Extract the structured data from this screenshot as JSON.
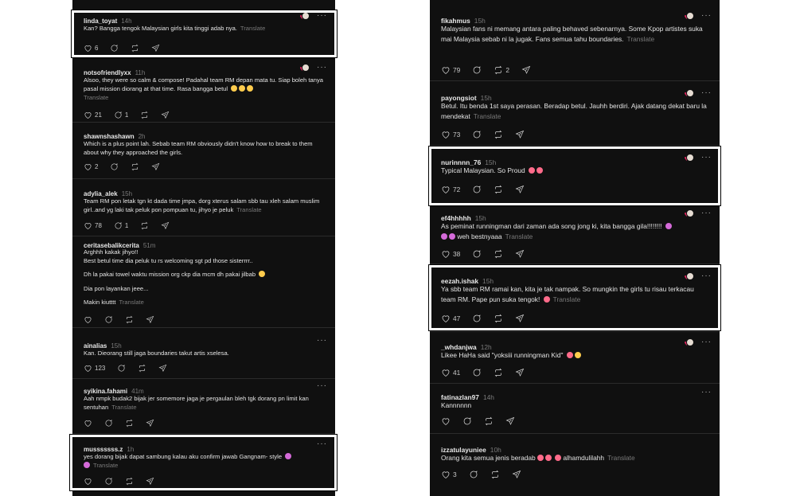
{
  "left": [
    {
      "user": "linda_toyat",
      "time": "14h",
      "text": "Kan? Bangga tengok Malaysian girls kita tinggi adab nya.",
      "translate": "Translate",
      "likes": "6",
      "replies": "",
      "reposts": "",
      "author_liked": true
    },
    {
      "user": "notsofriendlyxx",
      "time": "11h",
      "text": "Alsoo, they were so calm & compose! Padahal team RM depan mata tu. Siap boleh tanya pasal mission diorang at that time. Rasa bangga betul",
      "translate": "Translate",
      "likes": "21",
      "replies": "1",
      "reposts": "",
      "author_liked": true
    },
    {
      "user": "shawnshashawn",
      "time": "2h",
      "text": "Which is a plus point lah. Sebab team RM obviously didn't know how to break to them about why they approached the girls.",
      "translate": "",
      "likes": "2",
      "replies": "",
      "reposts": "",
      "author_liked": false
    },
    {
      "user": "adylia_alek",
      "time": "15h",
      "text": "Team RM pon letak tgn kt dada time jmpa, dorg xterus salam sbb tau xleh salam muslim girl..and yg laki tak peluk pon pompuan tu, jihyo je peluk",
      "translate": "Translate",
      "likes": "78",
      "replies": "1",
      "reposts": "",
      "author_liked": false
    },
    {
      "user": "ceritasebalikcerita",
      "time": "51m",
      "lines": [
        "Arghhh kakak jihyo!!",
        "Best betul time dia peluk tu rs welcoming sgt pd those sisterrrr..",
        "",
        "Dh la pakai towel waktu mission org ckp dia mcm dh pakai jilbab",
        "",
        "Dia pon layankan jeee...",
        "",
        "Makin kiutttt"
      ],
      "translate": "Translate",
      "likes": "",
      "replies": "",
      "reposts": "",
      "author_liked": false
    },
    {
      "user": "ainalias",
      "time": "15h",
      "text": "Kan. Dieorang still jaga boundaries takut artis xselesa.",
      "translate": "",
      "likes": "123",
      "replies": "",
      "reposts": "",
      "author_liked": false
    },
    {
      "user": "syikina.fahami",
      "time": "41m",
      "text": "Aah nmpk budak2 bijak jer somemore jaga je pergaulan bleh tgk dorang pn limit kan sentuhan",
      "translate": "Translate",
      "likes": "",
      "replies": "",
      "reposts": "",
      "author_liked": false
    },
    {
      "user": "musssssss.z",
      "time": "1h",
      "text": "yes dorang bijak dapat sambung kalau aku confirm jawab Gangnam- style",
      "translate": "Translate",
      "likes": "",
      "replies": "",
      "reposts": "",
      "author_liked": false
    }
  ],
  "right": [
    {
      "user": "fikahmus",
      "time": "15h",
      "text": "Malaysian fans ni memang antara paling behaved sebenarnya. Some Kpop artistes suka mai Malaysia sebab ni la jugak. Fans semua tahu boundaries.",
      "translate": "Translate",
      "likes": "79",
      "replies": "",
      "reposts": "2",
      "author_liked": true
    },
    {
      "user": "payongsiot",
      "time": "15h",
      "text": "Betul. Itu benda 1st saya perasan. Beradap betul. Jauhh berdiri. Ajak datang dekat baru la mendekat",
      "translate": "Translate",
      "likes": "73",
      "replies": "",
      "reposts": "",
      "author_liked": true
    },
    {
      "user": "nurinnnn_76",
      "time": "15h",
      "text": "Typical Malaysian. So Proud",
      "translate": "",
      "likes": "72",
      "replies": "",
      "reposts": "",
      "author_liked": true
    },
    {
      "user": "ef4hhhhh",
      "time": "15h",
      "text": "As peminat runningman dari zaman ada song jong ki, kita bangga gila!!!!!!!!",
      "text2": "weh bestnyaaa",
      "translate": "Translate",
      "likes": "38",
      "replies": "",
      "reposts": "",
      "author_liked": true
    },
    {
      "user": "eezah.ishak",
      "time": "15h",
      "text": "Ya sbb team RM ramai kan, kita je tak nampak. So mungkin the girls tu risau terkacau team RM. Pape pun suka tengok!",
      "translate": "Translate",
      "likes": "47",
      "replies": "",
      "reposts": "",
      "author_liked": true
    },
    {
      "user": "_whdanjwa",
      "time": "12h",
      "text": "Likee HaHa said \"yoksiii runningman Kid\"",
      "translate": "",
      "likes": "41",
      "replies": "",
      "reposts": "",
      "author_liked": true
    },
    {
      "user": "fatinazlan97",
      "time": "14h",
      "text": "Kannnnnn",
      "translate": "",
      "likes": "",
      "replies": "",
      "reposts": "",
      "author_liked": false
    },
    {
      "user": "izzatulayuniee",
      "time": "10h",
      "text": "Orang kita semua jenis beradab",
      "text2": "alhamdulilahh",
      "translate": "Translate",
      "likes": "3",
      "replies": "",
      "reposts": "",
      "author_liked": false
    }
  ],
  "icons": [
    "heart-icon",
    "reply-icon",
    "repost-icon",
    "share-icon",
    "more-icon"
  ],
  "colors": {
    "background": "#101010",
    "text": "#e4e4e4",
    "muted": "#7a7a7a",
    "highlight": "#ffffff",
    "liked_heart": "#e0245e"
  }
}
